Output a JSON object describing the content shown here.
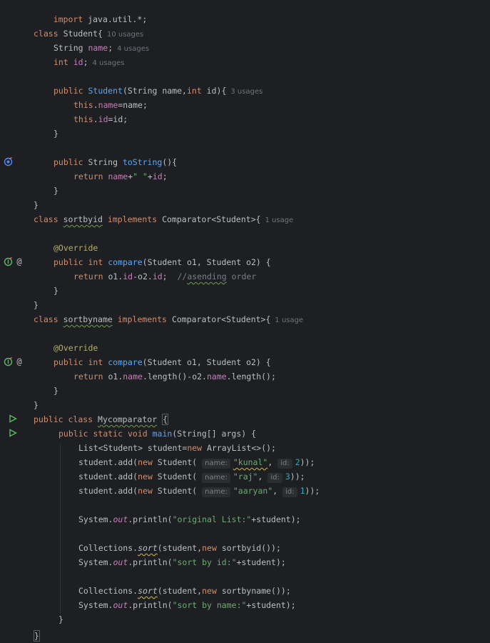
{
  "code": {
    "l1": "import java.util.*;",
    "class_kw": "class",
    "student_name": "Student",
    "brace_open": "{",
    "brace_close": "}",
    "usages_10": "10 usages",
    "usages_4": "4 usages",
    "usages_3": "3 usages",
    "usage_1": "1 usage",
    "string_t": "String",
    "int_t": "int",
    "name_f": "name",
    "id_f": "id",
    "public": "public",
    "this": "this",
    "return": "return",
    "toString": "toString",
    "sortbyid": "sortbyid",
    "sortbyname": "sortbyname",
    "implements": "implements",
    "comparator": "Comparator<Student>{",
    "override": "@Override",
    "compare": "compare",
    "comment": "//",
    "comment_word": "asending",
    "comment_rest": " order",
    "mycomparator": "Mycomparator",
    "static": "static",
    "void": "void",
    "main": "main",
    "new": "new",
    "str_kunal": "\"kunal\"",
    "str_raj": "\"raj\"",
    "str_aaryan": "\"aaryan\"",
    "str_space": "\" \"",
    "str_original": "\"original List:\"",
    "str_sortid": "\"sort by id:\"",
    "str_sortname": "\"sort by name:\"",
    "n1": "1",
    "n2": "2",
    "n3": "3",
    "hint_name": "name:",
    "hint_id": "id:",
    "out": "out",
    "sort": "sort"
  }
}
